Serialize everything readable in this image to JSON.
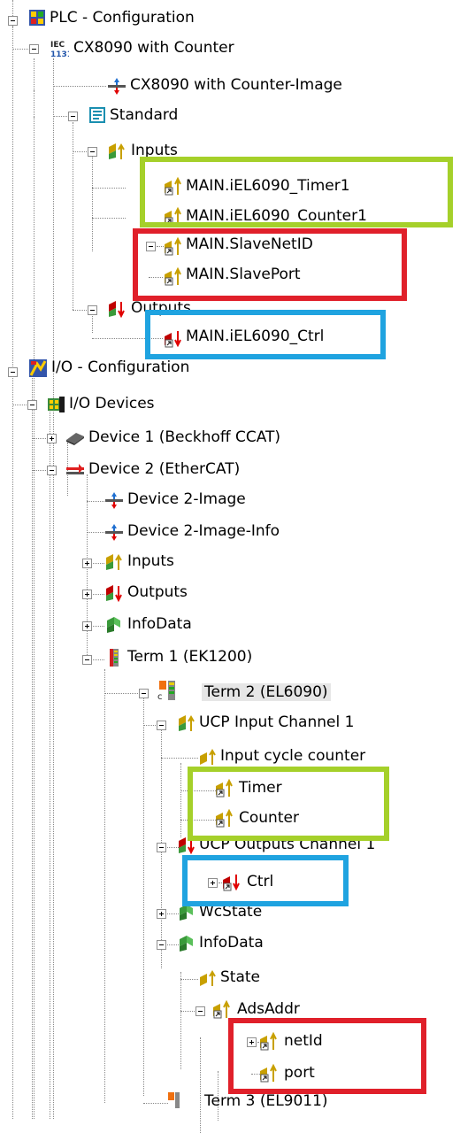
{
  "tree": {
    "plc_configuration": "PLC - Configuration",
    "cx8090_with_counter": "CX8090 with Counter",
    "cx8090_image": "CX8090 with Counter-Image",
    "standard": "Standard",
    "plc_inputs": "Inputs",
    "main_timer1": "MAIN.iEL6090_Timer1",
    "main_counter1": "MAIN.iEL6090_Counter1",
    "main_slavenetid": "MAIN.SlaveNetID",
    "main_slaveport": "MAIN.SlavePort",
    "plc_outputs": "Outputs",
    "main_ctrl": "MAIN.iEL6090_Ctrl",
    "io_configuration": "I/O - Configuration",
    "io_devices": "I/O Devices",
    "device1": "Device 1 (Beckhoff CCAT)",
    "device2": "Device 2 (EtherCAT)",
    "device2_image": "Device 2-Image",
    "device2_image_info": "Device 2-Image-Info",
    "dev_inputs": "Inputs",
    "dev_outputs": "Outputs",
    "dev_infodata": "InfoData",
    "term1": "Term 1 (EK1200)",
    "term2": "Term 2 (EL6090)",
    "ucp_input_channel": "UCP Input Channel 1",
    "input_cycle_counter": "Input cycle counter",
    "timer": "Timer",
    "counter": "Counter",
    "ucp_outputs_channel": "UCP Outputs Channel 1",
    "ctrl": "Ctrl",
    "wcstate": "WcState",
    "term2_infodata": "InfoData",
    "state": "State",
    "adsaddr": "AdsAddr",
    "netid": "netId",
    "port": "port",
    "term3": "Term 3 (EL9011)"
  },
  "iec_badge": "IEC\n1131",
  "colors": {
    "highlight_green": "#a5d02a",
    "highlight_red": "#e0202a",
    "highlight_blue": "#1fa3e0",
    "input_arrow": "#c8a000",
    "output_arrow": "#e00000",
    "var_green": "#3a9a3a"
  },
  "icons": [
    "plc-project-icon",
    "iec-icon",
    "image-icon",
    "task-icon",
    "inputs-icon",
    "input-variable-icon",
    "outputs-icon",
    "output-variable-icon",
    "io-config-icon",
    "io-devices-icon",
    "device-icon",
    "ethercat-icon",
    "coupler-icon",
    "terminal-icon",
    "infodata-icon",
    "status-variable-icon"
  ]
}
